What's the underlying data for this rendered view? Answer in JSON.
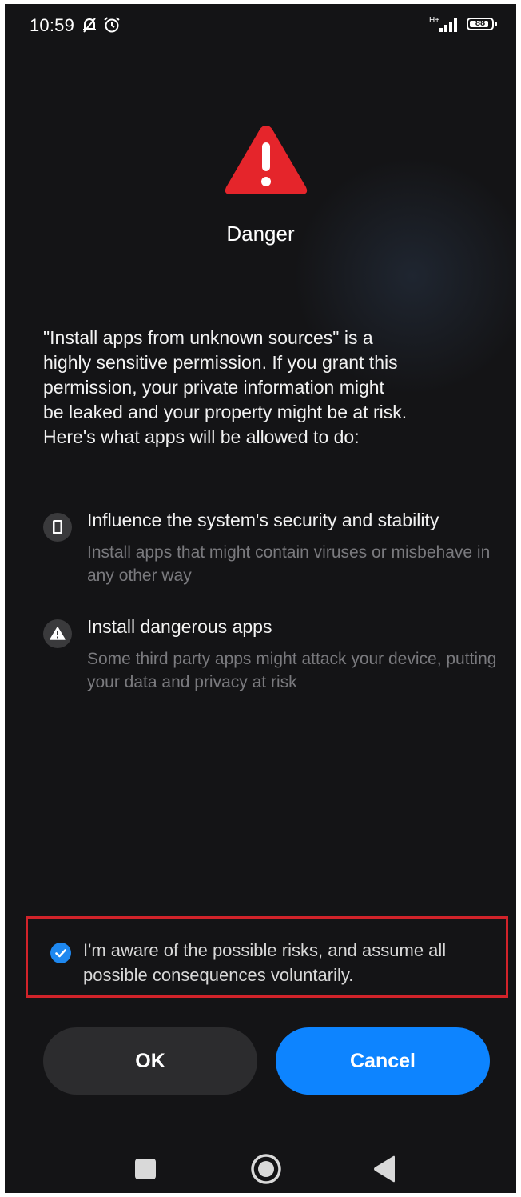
{
  "status_bar": {
    "time": "10:59",
    "network": "H+",
    "battery": "88",
    "battery_percent": 88,
    "icons": [
      "notifications-off-icon",
      "alarm-icon",
      "signal-icon",
      "battery-icon"
    ]
  },
  "dialog": {
    "icon": "warning-triangle-icon",
    "title": "Danger",
    "description": "\"Install apps from unknown sources\" is a\nhighly sensitive permission. If you grant this\npermission, your private information might\nbe leaked and your property might be at risk.\nHere's what apps will be allowed to do:",
    "permissions": [
      {
        "icon": "phone-icon",
        "title": "Influence the system's security and stability",
        "subtitle": "Install apps that might contain viruses or misbehave in any other way"
      },
      {
        "icon": "warning-icon",
        "title": "Install dangerous apps",
        "subtitle": "Some third party apps might attack your device, putting your data and privacy at risk"
      }
    ],
    "consent": {
      "checked": true,
      "text": "I'm aware of the possible risks, and assume all possible consequences voluntarily."
    },
    "buttons": {
      "ok": "OK",
      "cancel": "Cancel"
    }
  },
  "colors": {
    "background": "#141416",
    "danger_red": "#e5252b",
    "accent_blue": "#0d84ff",
    "highlight_border": "#d2232a"
  },
  "navbar": {
    "buttons": [
      "recents-icon",
      "home-icon",
      "back-icon"
    ]
  }
}
